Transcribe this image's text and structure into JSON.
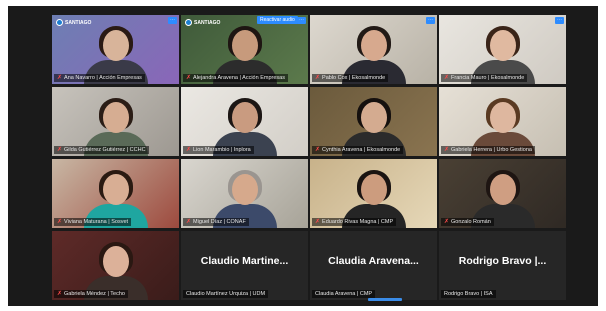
{
  "tiles": [
    {
      "name": "Ana Navarro | Acción Empresas",
      "kind": "video",
      "logo": "SANTIAGO",
      "skin": "#d8b49a",
      "hair": "#2a1a14",
      "shirt": "#3a3a48",
      "bg": "#6d7fb3",
      "bg2": "#8a66b8"
    },
    {
      "name": "Alejandra Aravena | Acción Empresas",
      "kind": "video",
      "logo": "SANTIAGO",
      "chip": "Reactivar audio",
      "skin": "#c79a7c",
      "hair": "#1e1512",
      "shirt": "#2c2c2c",
      "bg": "#3f5a3a",
      "bg2": "#5c7a4c"
    },
    {
      "name": "Pablo Cox | Ekosalmonde",
      "kind": "video",
      "active": true,
      "skin": "#d7a98e",
      "hair": "#221a16",
      "shirt": "#2a2a32",
      "bg": "#ddd8cf",
      "bg2": "#b8b2a6"
    },
    {
      "name": "Francia Mauro | Ekosalmonde",
      "kind": "video",
      "skin": "#e0b9a0",
      "hair": "#3a2418",
      "shirt": "#4a4a4a",
      "bg": "#e9e6e0",
      "bg2": "#cfcac2"
    },
    {
      "name": "Gilda Gutiérrez Gutiérrez | CCHC",
      "kind": "video",
      "skin": "#d6ad92",
      "hair": "#2b1d16",
      "shirt": "#5a6a58",
      "bg": "#c7c3bc",
      "bg2": "#9d9891"
    },
    {
      "name": "Lion Marambio | Inplora",
      "kind": "video",
      "skin": "#c99b80",
      "hair": "#1c1614",
      "shirt": "#3b4250",
      "bg": "#ebe8e3",
      "bg2": "#d2cec7"
    },
    {
      "name": "Cynthia Aravena | Ekosalmonde",
      "kind": "video",
      "skin": "#d4ab90",
      "hair": "#15100e",
      "shirt": "#2b2b2b",
      "bg": "#6b5a3c",
      "bg2": "#8a7450"
    },
    {
      "name": "Gabriela Herrera | Urbo Gestiona",
      "kind": "video",
      "skin": "#deb79f",
      "hair": "#5a3a22",
      "shirt": "#6a4a3a",
      "bg": "#e6e0d6",
      "bg2": "#c6bfb2"
    },
    {
      "name": "Viviana Maturana | Sosvet",
      "kind": "video",
      "skin": "#d8ae94",
      "hair": "#2a1a12",
      "shirt": "#1fa6a0",
      "bg": "#c8b7a4",
      "bg2": "#9d4a3e"
    },
    {
      "name": "Miguel Díaz | CONAF",
      "kind": "video",
      "skin": "#d6a98c",
      "hair": "#9a9590",
      "shirt": "#3c4a6a",
      "bg": "#d9d6cf",
      "bg2": "#a7a398"
    },
    {
      "name": "Eduardo Rivas Magna | CMP",
      "kind": "video",
      "skin": "#cc9c7e",
      "hair": "#1a1412",
      "shirt": "#252525",
      "bg": "#c8b28a",
      "bg2": "#e6d8b8"
    },
    {
      "name": "Gonzalo Román",
      "kind": "video",
      "skin": "#cf9e82",
      "hair": "#1e1512",
      "shirt": "#2a2a2a",
      "bg": "#4a4034",
      "bg2": "#2f2924"
    },
    {
      "name": "Gabriela Méndez | Techo",
      "kind": "video",
      "skin": "#dcb199",
      "hair": "#2a1812",
      "shirt": "#3a2e2a",
      "bg": "#5e2a28",
      "bg2": "#3a1c1a"
    },
    {
      "name": "Claudio Martínez Urquiza | UDM",
      "kind": "name",
      "display": "Claudio Martine..."
    },
    {
      "name": "Claudia Aravena | CMP",
      "kind": "name",
      "display": "Claudia Aravena..."
    },
    {
      "name": "Rodrigo Bravo | ISA",
      "kind": "name",
      "display": "Rodrigo Bravo |..."
    }
  ]
}
